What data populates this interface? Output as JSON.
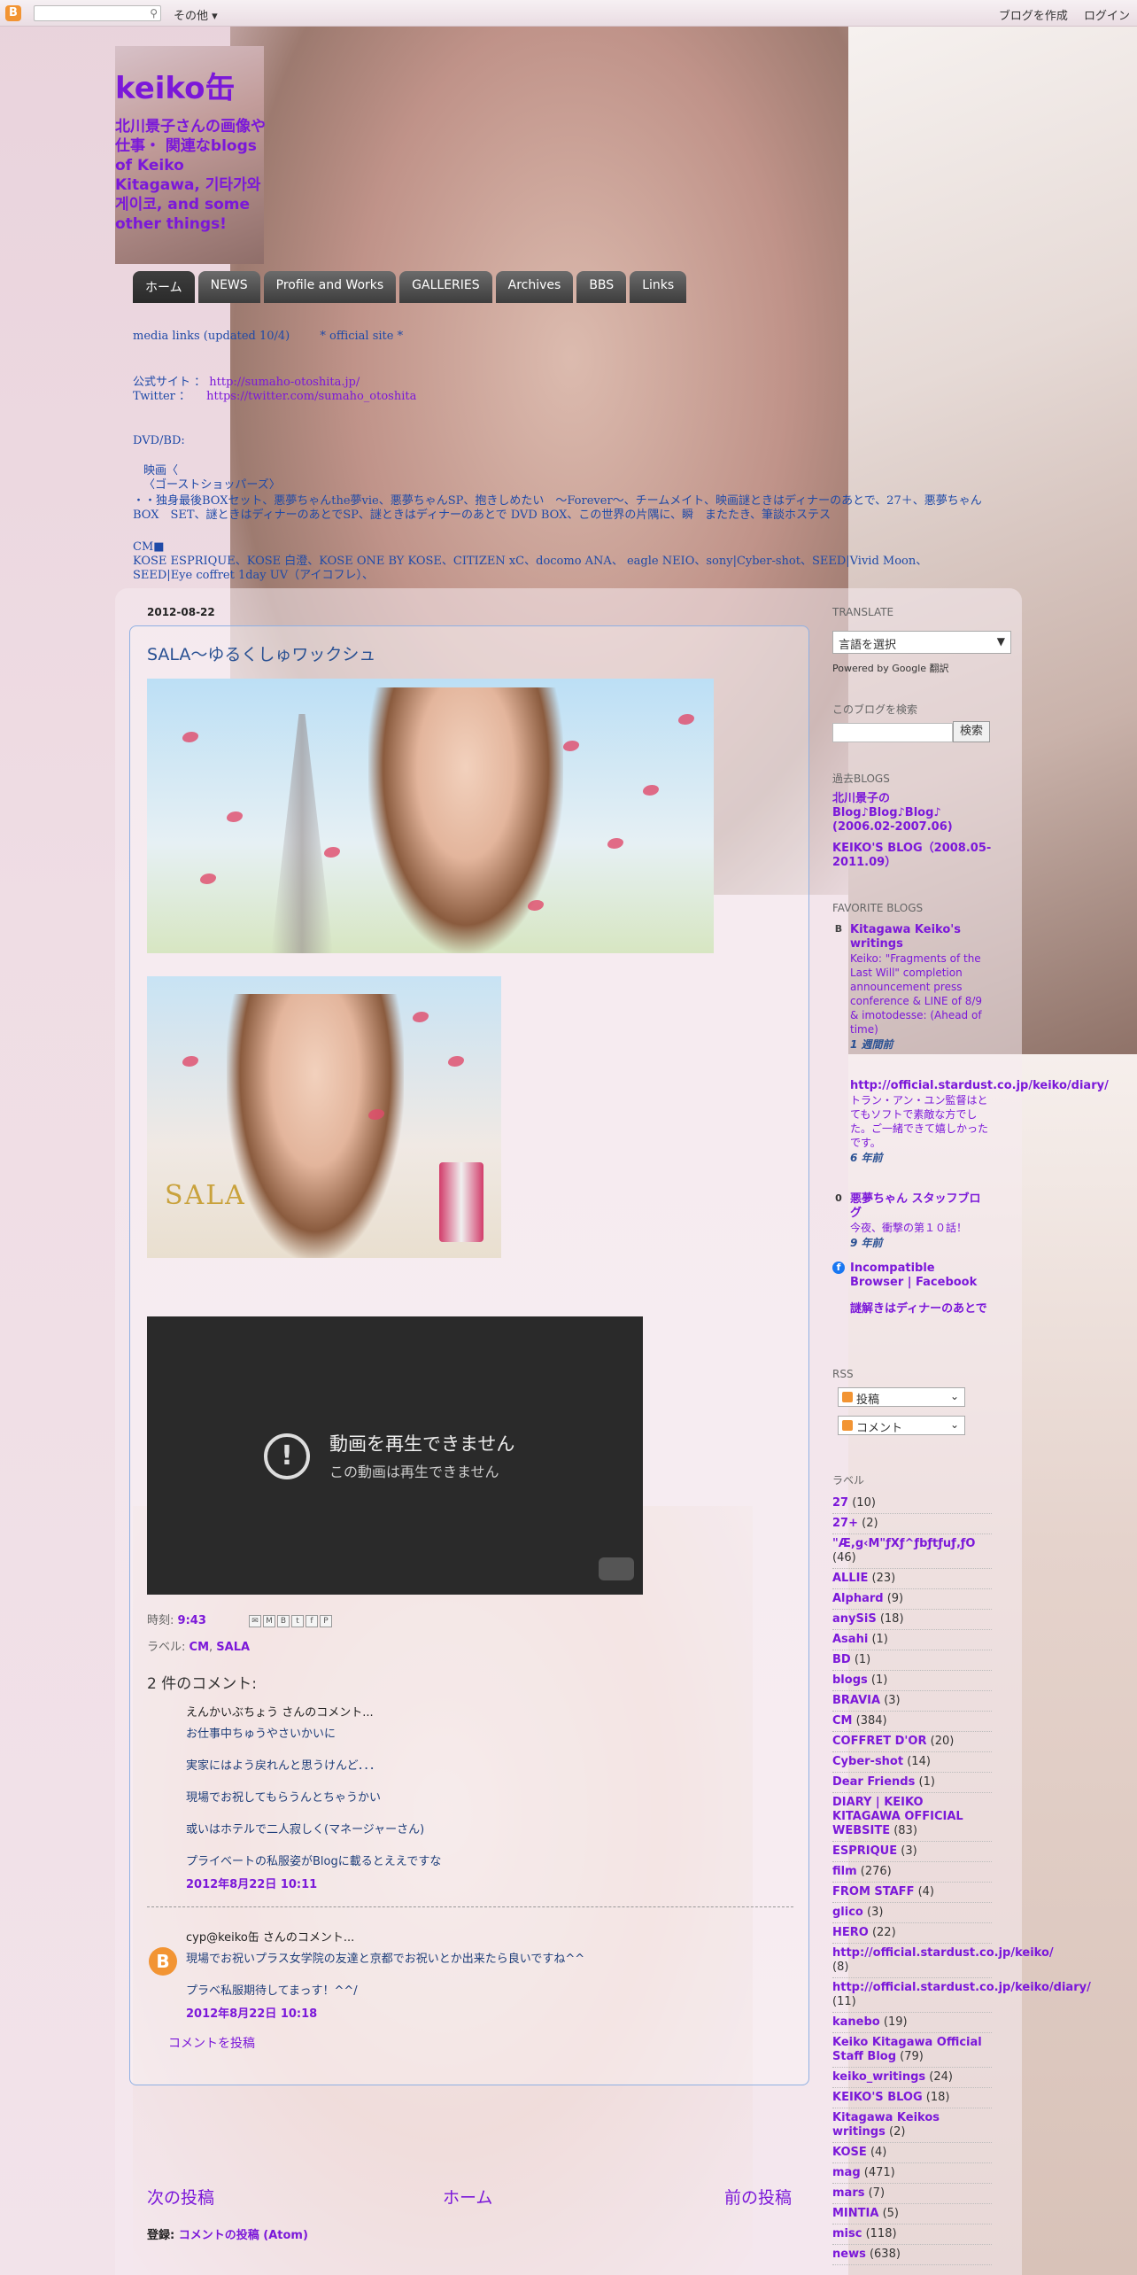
{
  "navbar": {
    "logo": "B",
    "more_label": "その他 ▾",
    "create_blog": "ブログを作成",
    "login": "ログイン"
  },
  "header": {
    "title": "keiko缶",
    "description": "北川景子さんの画像や 仕事・ 関連なblogs of Keiko Kitagawa, 기타가와 게이코, and some other things!"
  },
  "tabs": [
    "ホーム",
    "NEWS",
    "Profile and Works",
    "GALLERIES",
    "Archives",
    "BBS",
    "Links"
  ],
  "headlines": {
    "line1a": "media links (updated 10/4)",
    "line1b": "* official site *",
    "line2a": "公式サイト ：",
    "line2b": "http://sumaho-otoshita.jp/",
    "line3a": "Twitter ：",
    "line3b": "https://twitter.com/sumaho_otoshita",
    "dvd": "DVD/BD:",
    "dvd1": "映画〈",
    "dvd2": "〈ゴーストショッパーズ〉",
    "dvd3": "・・独身最後BOXセット、悪夢ちゃんthe夢vie、悪夢ちゃんSP、抱きしめたい　～Forever～、チームメイト、映画謎ときはディナーのあとで、27＋、悪夢ちゃん BOX　SET、謎ときはディナーのあとでSP、謎ときはディナーのあとで DVD BOX、この世界の片隅に、瞬　またたき、筆談ホステス",
    "cm": "CM■",
    "cm1": "KOSE ESPRIQUE、KOSE 白澄、KOSE ONE BY KOSE、CITIZEN xC、docomo ANA、 eagle NEIO、sony|Cyber-shot、SEED|Vivid Moon、SEED|Eye coffret 1day UV（アイコフレ）、"
  },
  "post": {
    "date": "2012-08-22",
    "title": "SALA～ゆるくしゅワックシュ",
    "img2_brand": "SALA",
    "video_title": "動画を再生できません",
    "video_sub": "この動画は再生できません",
    "time_label": "時刻:",
    "time_value": "9:43",
    "labels_label": "ラベル:",
    "label1": "CM",
    "label_sep": ",",
    "label2": "SALA"
  },
  "comments": {
    "title": "2 件のコメント:",
    "c1_author": "えんかいぶちょう さんのコメント...",
    "c1_lines": [
      "お仕事中ちゅうやさいかいに",
      "実家にはよう戻れんと思うけんど．．．",
      "現場でお祝してもらうんとちゃうかい",
      "或いはホテルで二人寂しく(マネージャーさん)",
      "プライベートの私服姿がBlogに載るとええですな"
    ],
    "c1_date": "2012年8月22日 10:11",
    "c2_author": "cyp@keiko缶 さんのコメント...",
    "c2_lines": [
      "現場でお祝いプラス女学院の友達と京都でお祝いとか出来たら良いですね^^",
      "プラベ私服期待してまっす！^^/"
    ],
    "c2_date": "2012年8月22日 10:18",
    "post_comment": "コメントを投稿"
  },
  "pager": {
    "newer": "次の投稿",
    "home": "ホーム",
    "older": "前の投稿",
    "subscribe_label": "登録:",
    "subscribe_link": "コメントの投稿 (Atom)"
  },
  "sidebar": {
    "translate_title": "TRANSLATE",
    "translate_select": "言語を選択",
    "powered": "Powered by Google 翻訳",
    "search_title": "このブログを検索",
    "search_button": "検索",
    "past_title": "過去BLOGS",
    "past1": "北川景子の Blog♪Blog♪Blog♪ (2006.02-2007.06)",
    "past2": "KEIKO'S BLOG（2008.05-2011.09）",
    "fav_title": "FAVORITE BLOGS",
    "fav1_name": "Kitagawa Keiko's writings",
    "fav1_post": "Keiko: \"Fragments of the Last Will\" completion announcement press conference & LINE of 8/9 & imotodesse: (Ahead of time)",
    "fav1_time": "1 週間前",
    "fav2_name": "http://official.stardust.co.jp/keiko/diary/",
    "fav2_post": "トラン・アン・ユン監督はとてもソフトで素敵な方でした。ご一緒できて嬉しかったです。",
    "fav2_time": "6 年前",
    "fav3_name": "悪夢ちゃん スタッフブログ",
    "fav3_post": "今夜、衝撃の第１０話！",
    "fav3_time": "9 年前",
    "fav4_name": "Incompatible Browser | Facebook",
    "fav5_name": "謎解きはディナーのあとで",
    "rss_title": "RSS",
    "rss1": "投稿",
    "rss2": "コメント",
    "labels_title": "ラベル",
    "labels": [
      {
        "name": "27",
        "count": "(10)"
      },
      {
        "name": "27+",
        "count": "(2)"
      },
      {
        "name": "\"Æ,g‹M\"ƒXƒ^ƒbƒtƒuƒ‚ƒO",
        "count": "(46)"
      },
      {
        "name": "ALLIE",
        "count": "(23)"
      },
      {
        "name": "Alphard",
        "count": "(9)"
      },
      {
        "name": "anySiS",
        "count": "(18)"
      },
      {
        "name": "Asahi",
        "count": "(1)"
      },
      {
        "name": "BD",
        "count": "(1)"
      },
      {
        "name": "blogs",
        "count": "(1)"
      },
      {
        "name": "BRAVIA",
        "count": "(3)"
      },
      {
        "name": "CM",
        "count": "(384)"
      },
      {
        "name": "COFFRET D'OR",
        "count": "(20)"
      },
      {
        "name": "Cyber-shot",
        "count": "(14)"
      },
      {
        "name": "Dear Friends",
        "count": "(1)"
      },
      {
        "name": "DIARY | KEIKO KITAGAWA OFFICIAL WEBSITE",
        "count": "(83)"
      },
      {
        "name": "ESPRIQUE",
        "count": "(3)"
      },
      {
        "name": "film",
        "count": "(276)"
      },
      {
        "name": "FROM STAFF",
        "count": "(4)"
      },
      {
        "name": "glico",
        "count": "(3)"
      },
      {
        "name": "HERO",
        "count": "(22)"
      },
      {
        "name": "http://official.stardust.co.jp/keiko/",
        "count": "(8)"
      },
      {
        "name": "http://official.stardust.co.jp/keiko/diary/",
        "count": "(11)"
      },
      {
        "name": "kanebo",
        "count": "(19)"
      },
      {
        "name": "Keiko Kitagawa Official Staff Blog",
        "count": "(79)"
      },
      {
        "name": "keiko_writings",
        "count": "(24)"
      },
      {
        "name": "KEIKO'S BLOG",
        "count": "(18)"
      },
      {
        "name": "Kitagawa Keikos writings",
        "count": "(2)"
      },
      {
        "name": "KOSE",
        "count": "(4)"
      },
      {
        "name": "mag",
        "count": "(471)"
      },
      {
        "name": "mars",
        "count": "(7)"
      },
      {
        "name": "MINTIA",
        "count": "(5)"
      },
      {
        "name": "misc",
        "count": "(118)"
      },
      {
        "name": "news",
        "count": "(638)"
      }
    ]
  }
}
